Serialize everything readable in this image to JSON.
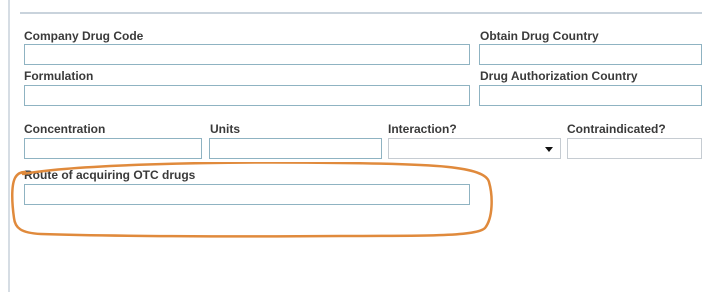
{
  "form": {
    "company_drug_code": {
      "label": "Company Drug Code",
      "value": ""
    },
    "obtain_drug_country": {
      "label": "Obtain Drug Country",
      "value": ""
    },
    "formulation": {
      "label": "Formulation",
      "value": ""
    },
    "drug_authorization_country": {
      "label": "Drug Authorization Country",
      "value": ""
    },
    "concentration": {
      "label": "Concentration",
      "value": ""
    },
    "units": {
      "label": "Units",
      "value": ""
    },
    "interaction": {
      "label": "Interaction?",
      "value": ""
    },
    "contraindicated": {
      "label": "Contraindicated?",
      "value": ""
    },
    "route_of_acquiring": {
      "label": "Route of acquiring OTC drugs",
      "value": ""
    }
  },
  "icons": {
    "dropdown": "chevron-down-icon"
  },
  "colors": {
    "field_border": "#8fb3c2",
    "highlight_outline": "#e08a3c",
    "label_text": "#3a3a3a"
  }
}
